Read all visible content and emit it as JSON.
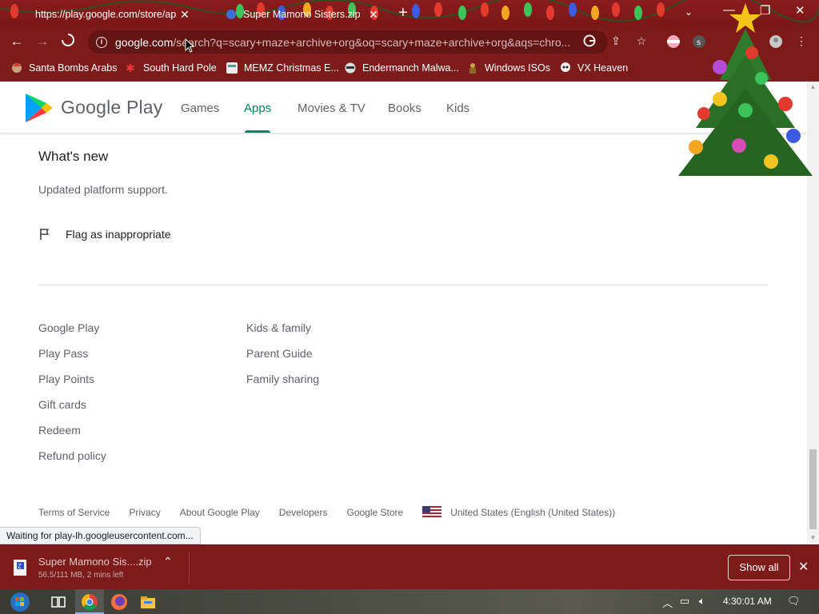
{
  "tabs": [
    {
      "title": "https://play.google.com/store/ap",
      "active": true
    },
    {
      "title": "Super Mamono Sisters.zip",
      "active": false
    }
  ],
  "omnibox": {
    "host": "google.com",
    "path": "/search?q=scary+maze+archive+org&oq=scary+maze+archive+org&aqs=chro..."
  },
  "bookmarks": [
    {
      "label": "Santa Bombs Arabs",
      "icon": "santa-icon"
    },
    {
      "label": "South Hard Pole",
      "icon": "snowflake-icon"
    },
    {
      "label": "MEMZ Christmas E...",
      "icon": "page-icon"
    },
    {
      "label": "Endermanch Malwa...",
      "icon": "raccoon-icon"
    },
    {
      "label": "Windows ISOs",
      "icon": "figure-icon"
    },
    {
      "label": "VX Heaven",
      "icon": "skull-icon"
    }
  ],
  "gplay": {
    "brand": "Google Play",
    "nav": [
      "Games",
      "Apps",
      "Movies & TV",
      "Books",
      "Kids"
    ],
    "active_nav": "Apps"
  },
  "whats_new": {
    "title": "What's new",
    "body": "Updated platform support."
  },
  "flag_label": "Flag as inappropriate",
  "footer": {
    "col1": {
      "heading": "Google Play",
      "links": [
        "Play Pass",
        "Play Points",
        "Gift cards",
        "Redeem",
        "Refund policy"
      ]
    },
    "col2": {
      "heading": "Kids & family",
      "links": [
        "Parent Guide",
        "Family sharing"
      ]
    },
    "legal": [
      "Terms of Service",
      "Privacy",
      "About Google Play",
      "Developers",
      "Google Store"
    ],
    "locale": "United States (English (United States))"
  },
  "status_text": "Waiting for play-lh.googleusercontent.com...",
  "download": {
    "name": "Super Mamono Sis....zip",
    "status": "56.5/111 MB, 2 mins left",
    "show_all": "Show all"
  },
  "taskbar": {
    "clock": "4:30:01 AM"
  },
  "colors": {
    "chrome_theme": "#7d1b1b",
    "gplay_green": "#01875f",
    "text_secondary": "#5f6368"
  }
}
